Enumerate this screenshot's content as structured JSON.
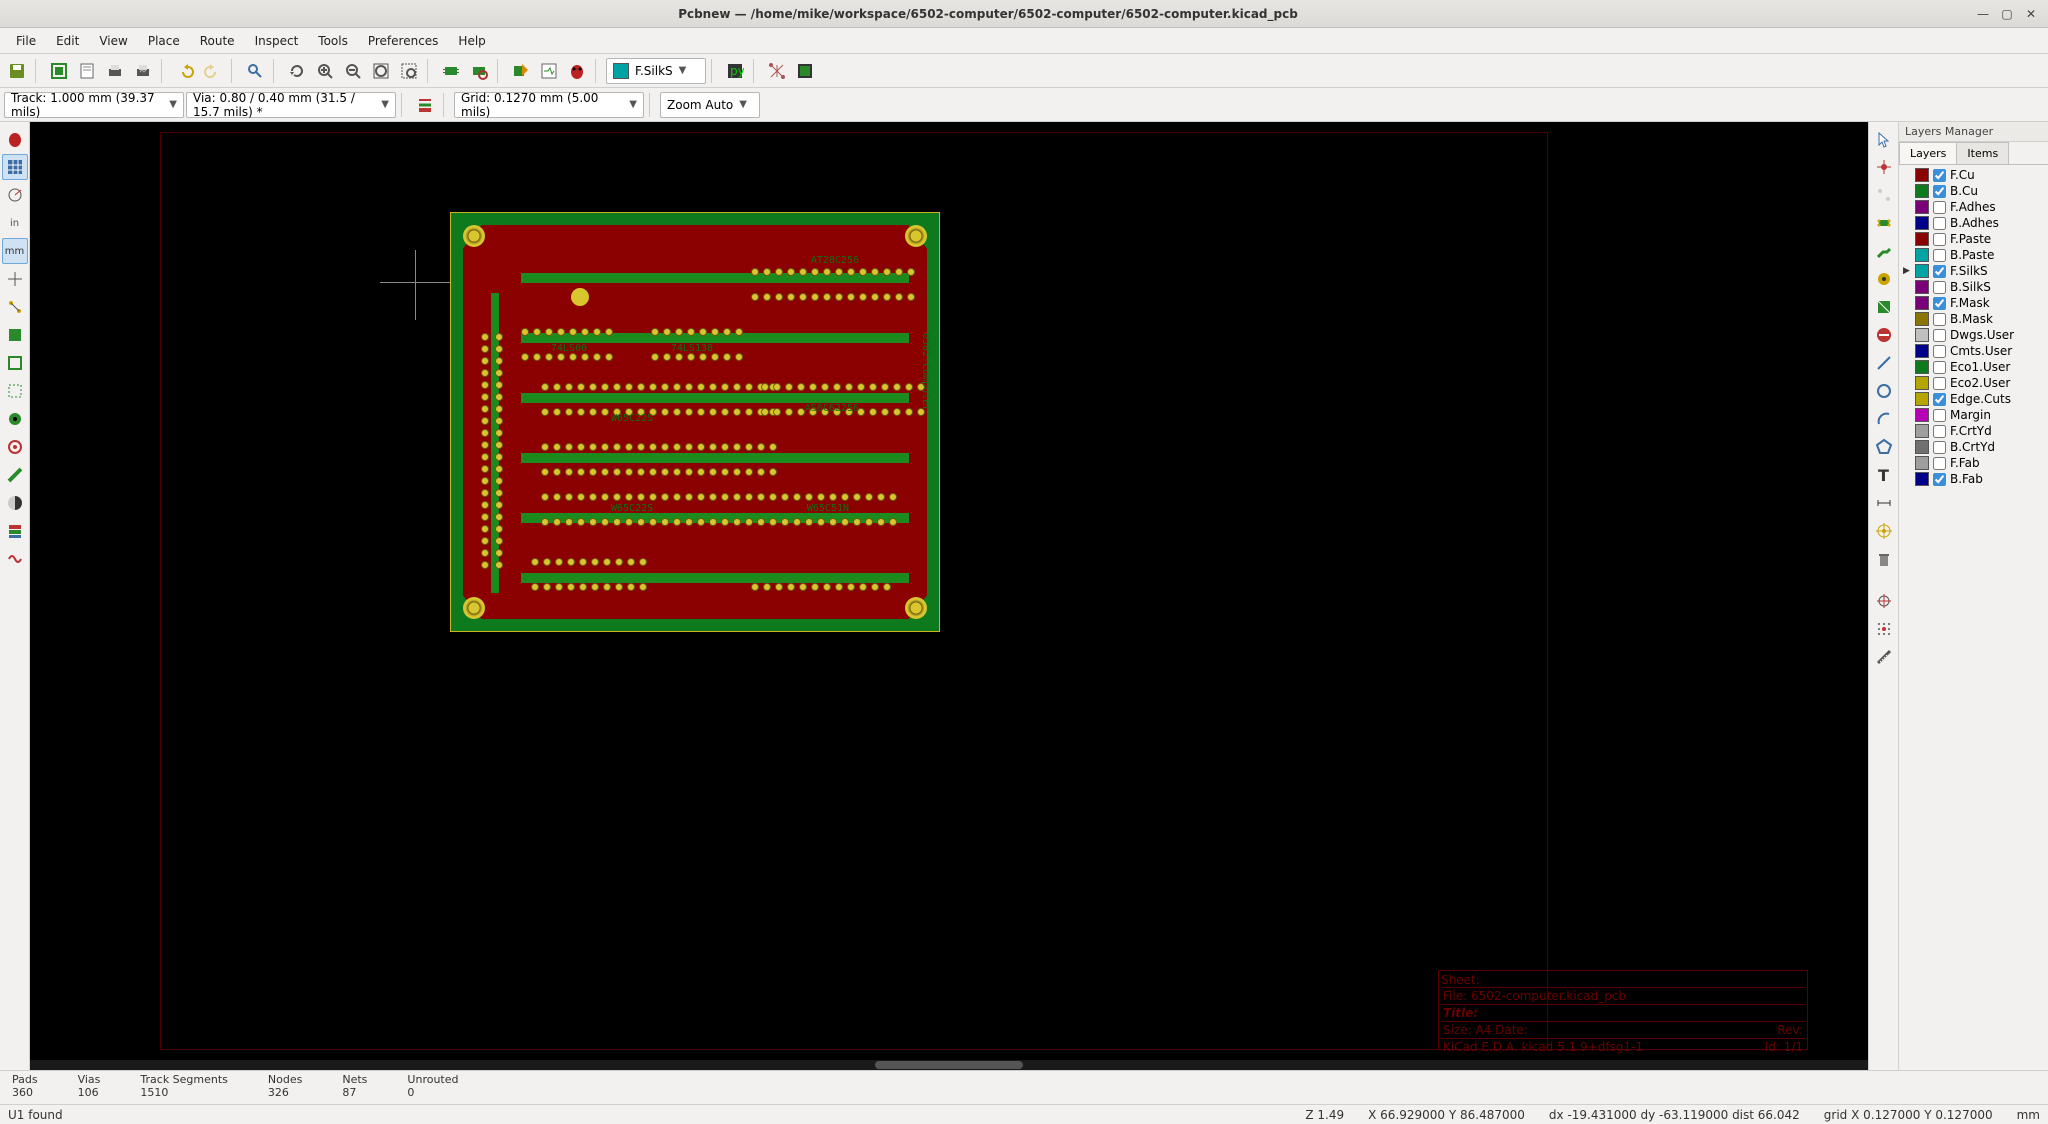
{
  "title": "Pcbnew — /home/mike/workspace/6502-computer/6502-computer/6502-computer.kicad_pcb",
  "menu": [
    "File",
    "Edit",
    "View",
    "Place",
    "Route",
    "Inspect",
    "Tools",
    "Preferences",
    "Help"
  ],
  "toolbar1": {
    "layer_dropdown": "F.SilkS",
    "layer_color": "#00a3a3"
  },
  "toolbar2": {
    "track": "Track: 1.000 mm (39.37 mils)",
    "via": "Via: 0.80 / 0.40 mm (31.5 / 15.7 mils) *",
    "grid": "Grid: 0.1270 mm (5.00 mils)",
    "zoom": "Zoom Auto"
  },
  "pcb_labels": {
    "at28c256": "AT28C256",
    "as6c62256": "AS6C62256",
    "w65c22s_1": "W65C22S",
    "w65c22s_2": "W65C22S",
    "w65c51n": "W65C51N",
    "ic_7400": "74LS00",
    "ic_7410": "74LS138",
    "board": "6502-Computer"
  },
  "titleblock": {
    "sheet": "Sheet:",
    "file": "File: 6502-computer.kicad_pcb",
    "title": "Title:",
    "size": "Size: A4        Date:",
    "kicad": "KiCad E.D.A.  kicad 5.1.9+dfsg1-1",
    "rev": "Rev:",
    "id": "Id: 1/1"
  },
  "layers_panel": {
    "title": "Layers Manager",
    "tabs": [
      "Layers",
      "Items"
    ],
    "layers": [
      {
        "name": "F.Cu",
        "color": "#8b0000",
        "checked": true,
        "active": false
      },
      {
        "name": "B.Cu",
        "color": "#0d7a1d",
        "checked": true,
        "active": false
      },
      {
        "name": "F.Adhes",
        "color": "#7a007a",
        "checked": false,
        "active": false
      },
      {
        "name": "B.Adhes",
        "color": "#00008b",
        "checked": false,
        "active": false
      },
      {
        "name": "F.Paste",
        "color": "#8b0000",
        "checked": false,
        "active": false
      },
      {
        "name": "B.Paste",
        "color": "#00a3a3",
        "checked": false,
        "active": false
      },
      {
        "name": "F.SilkS",
        "color": "#00a3a3",
        "checked": true,
        "active": true
      },
      {
        "name": "B.SilkS",
        "color": "#7a007a",
        "checked": false,
        "active": false
      },
      {
        "name": "F.Mask",
        "color": "#7a007a",
        "checked": true,
        "active": false
      },
      {
        "name": "B.Mask",
        "color": "#8b7500",
        "checked": false,
        "active": false
      },
      {
        "name": "Dwgs.User",
        "color": "#bfbfbf",
        "checked": false,
        "active": false
      },
      {
        "name": "Cmts.User",
        "color": "#00008b",
        "checked": false,
        "active": false
      },
      {
        "name": "Eco1.User",
        "color": "#0d7a1d",
        "checked": false,
        "active": false
      },
      {
        "name": "Eco2.User",
        "color": "#b5a500",
        "checked": false,
        "active": false
      },
      {
        "name": "Edge.Cuts",
        "color": "#b5a500",
        "checked": true,
        "active": false
      },
      {
        "name": "Margin",
        "color": "#b500b5",
        "checked": false,
        "active": false
      },
      {
        "name": "F.CrtYd",
        "color": "#9e9e9e",
        "checked": false,
        "active": false
      },
      {
        "name": "B.CrtYd",
        "color": "#707070",
        "checked": false,
        "active": false
      },
      {
        "name": "F.Fab",
        "color": "#9e9e9e",
        "checked": false,
        "active": false
      },
      {
        "name": "B.Fab",
        "color": "#00008b",
        "checked": true,
        "active": false
      }
    ]
  },
  "stats": {
    "pads_l": "Pads",
    "pads_v": "360",
    "vias_l": "Vias",
    "vias_v": "106",
    "tracks_l": "Track Segments",
    "tracks_v": "1510",
    "nodes_l": "Nodes",
    "nodes_v": "326",
    "nets_l": "Nets",
    "nets_v": "87",
    "unrouted_l": "Unrouted",
    "unrouted_v": "0"
  },
  "status": {
    "msg": "U1 found",
    "z": "Z 1.49",
    "xy": "X 66.929000  Y 86.487000",
    "dxy": "dx -19.431000  dy -63.119000  dist 66.042",
    "grid": "grid X 0.127000  Y 0.127000",
    "unit": "mm"
  }
}
